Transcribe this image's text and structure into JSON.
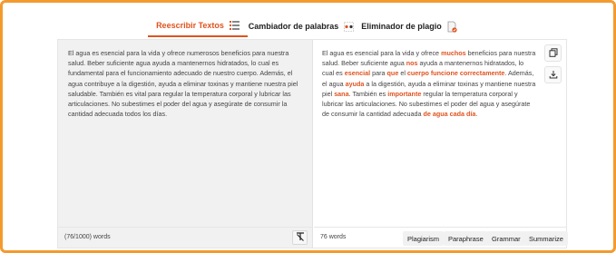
{
  "tabs": [
    {
      "label": "Reescribir Textos",
      "active": true
    },
    {
      "label": "Cambiador de palabras",
      "active": false
    },
    {
      "label": "Eliminador de plagio",
      "active": false
    }
  ],
  "input": {
    "text": "El agua es esencial para la vida y ofrece numerosos beneficios para nuestra salud. Beber suficiente agua ayuda a mantenernos hidratados, lo cual es fundamental para el funcionamiento adecuado de nuestro cuerpo. Además, el agua contribuye a la digestión, ayuda a eliminar toxinas y mantiene nuestra piel saludable. También es vital para regular la temperatura corporal y lubricar las articulaciones. No subestimes el poder del agua y asegúrate de consumir la cantidad adecuada todos los días.",
    "word_count": "(76/1000) words"
  },
  "output": {
    "segments": [
      {
        "t": "El agua es esencial para la vida y ofrece ",
        "h": false
      },
      {
        "t": "muchos",
        "h": true
      },
      {
        "t": " beneficios para nuestra salud. Beber suficiente agua ",
        "h": false
      },
      {
        "t": "nos",
        "h": true
      },
      {
        "t": " ayuda a mantenernos hidratados, lo cual es ",
        "h": false
      },
      {
        "t": "esencial",
        "h": true
      },
      {
        "t": " para ",
        "h": false
      },
      {
        "t": "que",
        "h": true
      },
      {
        "t": " el ",
        "h": false
      },
      {
        "t": "cuerpo funcione correctamente",
        "h": true
      },
      {
        "t": ". Además, el agua ",
        "h": false
      },
      {
        "t": "ayuda",
        "h": true
      },
      {
        "t": " a la digestión, ayuda a eliminar toxinas y mantiene nuestra piel ",
        "h": false
      },
      {
        "t": "sana",
        "h": true
      },
      {
        "t": ". También es ",
        "h": false
      },
      {
        "t": "importante",
        "h": true
      },
      {
        "t": " regular la temperatura corporal y lubricar las articulaciones. No subestimes el poder del agua y asegúrate de consumir la cantidad adecuada ",
        "h": false
      },
      {
        "t": "de agua cada día",
        "h": true
      },
      {
        "t": ".",
        "h": false
      }
    ],
    "word_count": "76 words"
  },
  "actions": {
    "plagiarism": "Plagiarism",
    "paraphrase": "Paraphrase",
    "grammar": "Grammar",
    "summarize": "Summarize"
  },
  "icons": {
    "tab1": "list-icon",
    "tab2": "shuffle-dots-icon",
    "tab3": "document-check-icon",
    "copy": "copy-icon",
    "download": "download-icon",
    "clear": "clear-format-icon"
  },
  "colors": {
    "accent": "#e0531f",
    "frame": "#f39a2e"
  }
}
